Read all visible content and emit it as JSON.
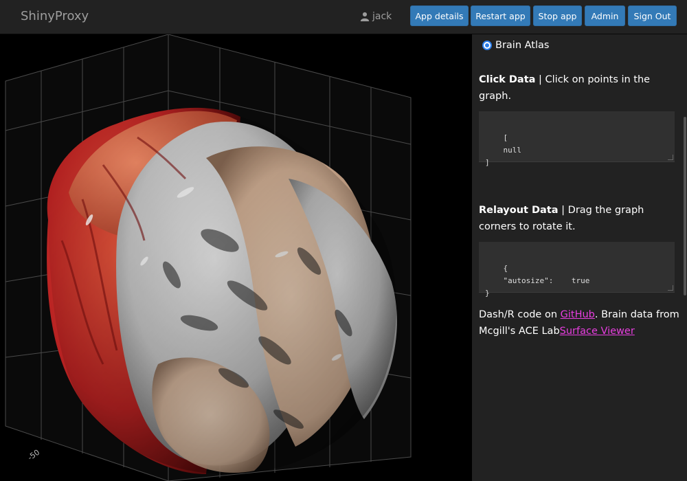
{
  "navbar": {
    "brand": "ShinyProxy",
    "user": "jack",
    "buttons": {
      "app_details": "App details",
      "restart_app": "Restart app",
      "stop_app": "Stop app",
      "admin": "Admin",
      "sign_out": "Sign Out"
    }
  },
  "graph": {
    "tick_label": "-50"
  },
  "panel": {
    "radio_label": "Brain Atlas",
    "click_data": {
      "title": "Click Data",
      "description": " | Click on points in the graph.",
      "code": "[\n    null\n]"
    },
    "relayout_data": {
      "title": "Relayout Data",
      "description": " | Drag the graph corners to rotate it.",
      "code": "{\n    \"autosize\":    true\n}"
    },
    "footer": {
      "text1": "Dash/R code on ",
      "link1": "GitHub",
      "text2": ". Brain data from Mcgill's ACE Lab",
      "link2": "Surface Viewer"
    }
  },
  "colors": {
    "navbar_bg": "#222222",
    "button_bg": "#337ab7",
    "link": "#e83ee0",
    "panel_bg": "#222222"
  }
}
